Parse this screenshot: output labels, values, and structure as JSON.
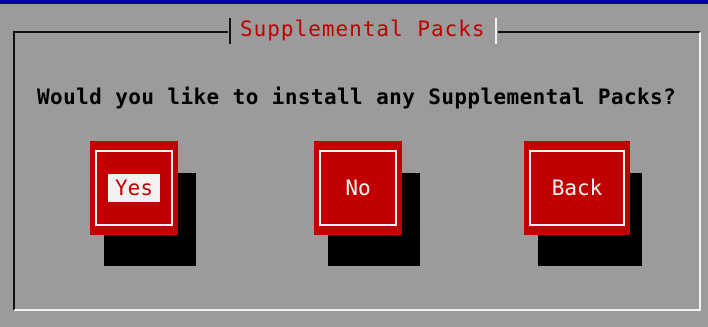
{
  "dialog": {
    "title": "Supplemental Packs",
    "question": "Would you like to install any Supplemental Packs?"
  },
  "buttons": {
    "yes": "Yes",
    "no": "No",
    "back": "Back"
  },
  "selected_button": "yes",
  "colors": {
    "background": "#9b9b9b",
    "accent": "#c00000",
    "highlight": "#f2f2f2",
    "shadow": "#000000",
    "top_strip": "#0000a8"
  }
}
